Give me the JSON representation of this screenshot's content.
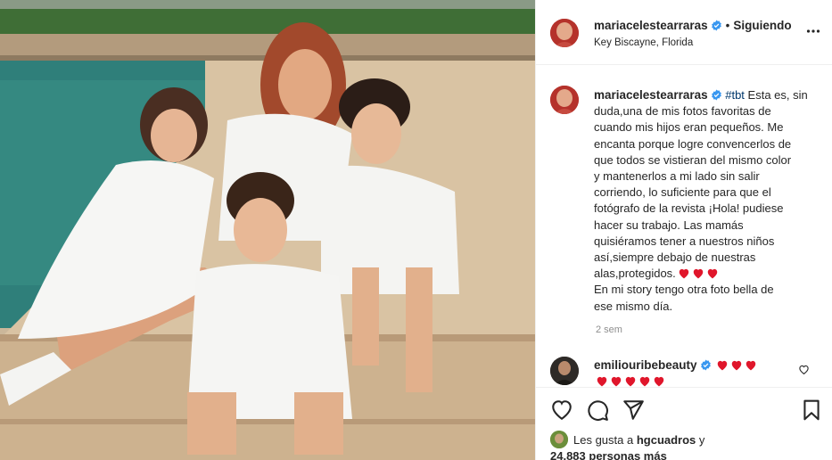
{
  "post": {
    "username": "mariacelestearraras",
    "follow_status": "Siguiendo",
    "location": "Key Biscayne, Florida"
  },
  "caption": {
    "username": "mariacelestearraras",
    "hashtag": "#tbt",
    "lines": [
      " Esta es, sin",
      "duda,una de mis fotos favoritas de",
      "cuando mis hijos eran pequeños. Me",
      "encanta porque logre convencerlos de",
      "que todos se vistieran del mismo color",
      "y mantenerlos a mi lado sin salir",
      "corriendo, lo suficiente para que el",
      "fotógrafo de la revista ¡Hola! pudiese",
      "hacer su trabajo. Las mamás",
      "quisiéramos tener a nuestros niños",
      "así,siempre debajo de nuestras",
      "alas,protegidos.",
      "En mi story tengo otra foto bella de",
      "ese mismo día."
    ],
    "time_ago": "2 sem"
  },
  "reply": {
    "username": "emiliouribebeauty"
  },
  "likes": {
    "prefix": "Les gusta a ",
    "user": "hgcuadros",
    "conj": " y",
    "count": "24,883 personas más"
  },
  "icons": [
    "more-options-icon",
    "verified-badge-icon",
    "heart-icon",
    "comment-icon",
    "share-icon",
    "bookmark-icon"
  ],
  "colors": {
    "verified": "#3897f0",
    "heart_emoji": "#e0162b",
    "tag": "#00376b",
    "muted": "#8e8e8e"
  }
}
